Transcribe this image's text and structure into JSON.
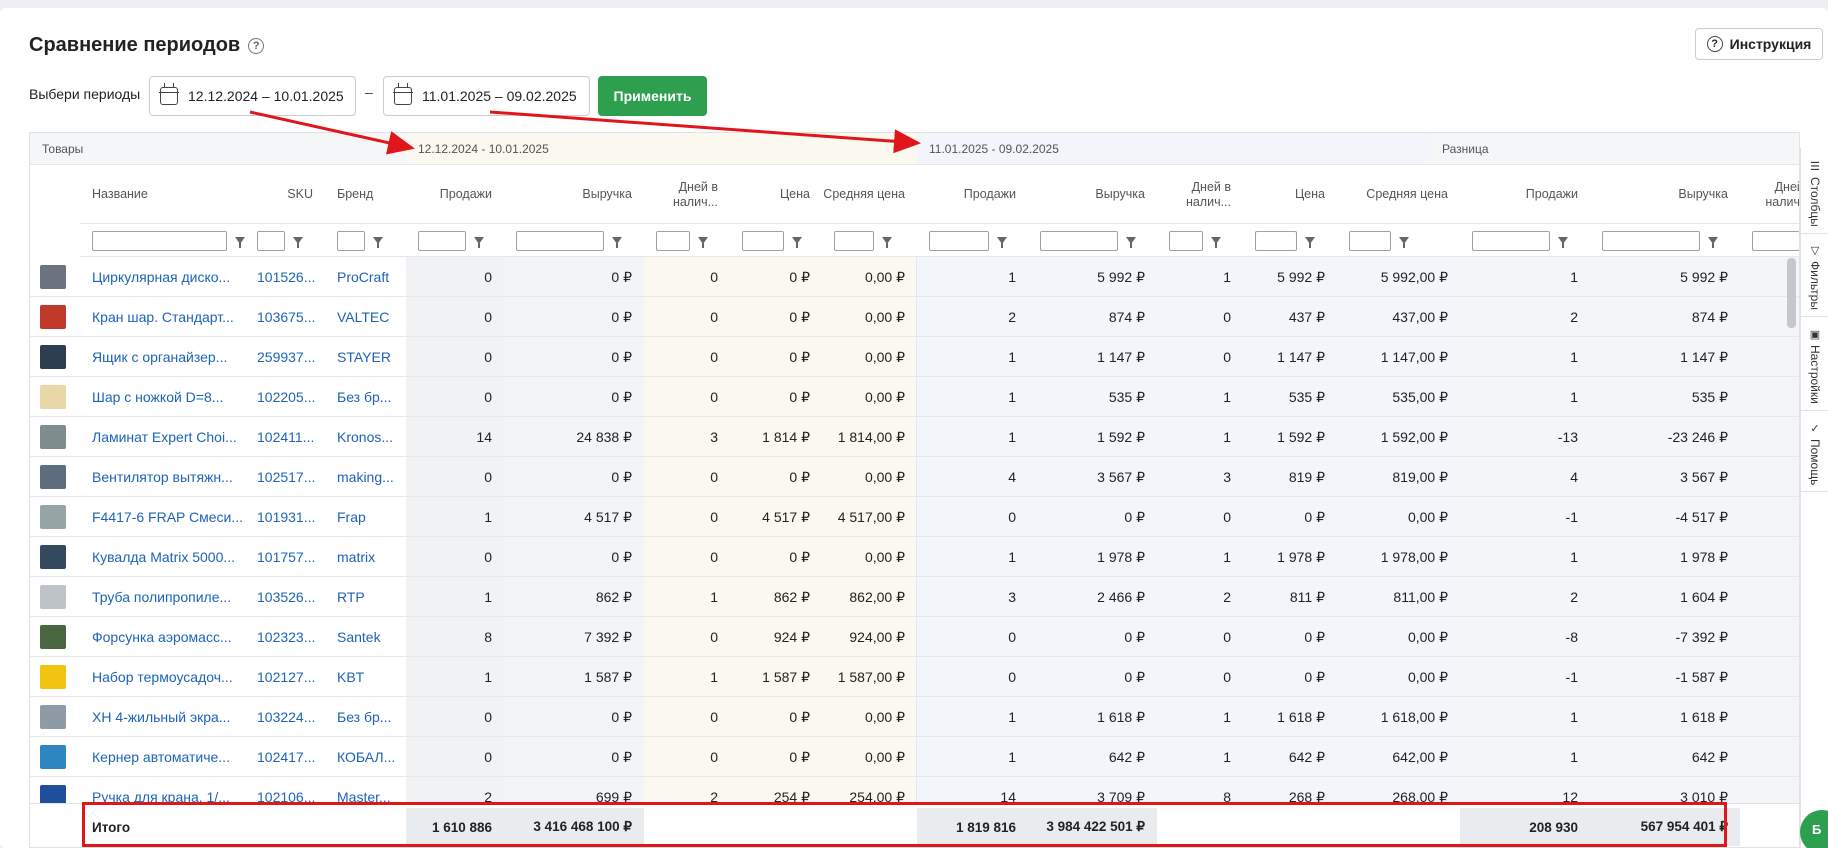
{
  "page": {
    "title": "Сравнение периодов",
    "help_icon": "?",
    "instruction_button": "Инструкция",
    "period_label": "Выбери периоды",
    "period1_value": "12.12.2024 – 10.01.2025",
    "separator": "–",
    "period2_value": "11.01.2025 – 09.02.2025",
    "apply_button": "Применить"
  },
  "table": {
    "groups": {
      "goods": "Товары",
      "period1": "12.12.2024 - 10.01.2025",
      "period2": "11.01.2025 - 09.02.2025",
      "diff": "Разница"
    },
    "headers": {
      "name": "Название",
      "sku": "SKU",
      "brand": "Бренд",
      "p1_sales": "Продажи",
      "p1_revenue": "Выручка",
      "p1_days": "Дней в налич...",
      "p1_price": "Цена",
      "p1_avg_price": "Средняя цена",
      "p2_sales": "Продажи",
      "p2_revenue": "Выручка",
      "p2_days": "Дней в налич...",
      "p2_price": "Цена",
      "p2_avg_price": "Средняя цена",
      "d_sales": "Продажи",
      "d_revenue": "Выручка",
      "d_days": "Дней в наличии"
    },
    "rows": [
      {
        "name": "Циркулярная диско...",
        "sku": "101526...",
        "brand": "ProCraft",
        "p1": [
          "0",
          "0 ₽",
          "0",
          "0 ₽",
          "0,00 ₽"
        ],
        "p2": [
          "1",
          "5 992 ₽",
          "1",
          "5 992 ₽",
          "5 992,00 ₽"
        ],
        "d": [
          "1",
          "5 992 ₽"
        ]
      },
      {
        "name": "Кран шар. Стандарт...",
        "sku": "103675...",
        "brand": "VALTEC",
        "p1": [
          "0",
          "0 ₽",
          "0",
          "0 ₽",
          "0,00 ₽"
        ],
        "p2": [
          "2",
          "874 ₽",
          "0",
          "437 ₽",
          "437,00 ₽"
        ],
        "d": [
          "2",
          "874 ₽"
        ]
      },
      {
        "name": "Ящик с органайзер...",
        "sku": "259937...",
        "brand": "STAYER",
        "p1": [
          "0",
          "0 ₽",
          "0",
          "0 ₽",
          "0,00 ₽"
        ],
        "p2": [
          "1",
          "1 147 ₽",
          "0",
          "1 147 ₽",
          "1 147,00 ₽"
        ],
        "d": [
          "1",
          "1 147 ₽"
        ]
      },
      {
        "name": "Шар с ножкой D=8...",
        "sku": "102205...",
        "brand": "Без бр...",
        "p1": [
          "0",
          "0 ₽",
          "0",
          "0 ₽",
          "0,00 ₽"
        ],
        "p2": [
          "1",
          "535 ₽",
          "1",
          "535 ₽",
          "535,00 ₽"
        ],
        "d": [
          "1",
          "535 ₽"
        ]
      },
      {
        "name": "Ламинат Expert Choi...",
        "sku": "102411...",
        "brand": "Kronos...",
        "p1": [
          "14",
          "24 838 ₽",
          "3",
          "1 814 ₽",
          "1 814,00 ₽"
        ],
        "p2": [
          "1",
          "1 592 ₽",
          "1",
          "1 592 ₽",
          "1 592,00 ₽"
        ],
        "d": [
          "-13",
          "-23 246 ₽"
        ]
      },
      {
        "name": "Вентилятор вытяжн...",
        "sku": "102517...",
        "brand": "making...",
        "p1": [
          "0",
          "0 ₽",
          "0",
          "0 ₽",
          "0,00 ₽"
        ],
        "p2": [
          "4",
          "3 567 ₽",
          "3",
          "819 ₽",
          "819,00 ₽"
        ],
        "d": [
          "4",
          "3 567 ₽"
        ]
      },
      {
        "name": "F4417-6 FRAP Смеси...",
        "sku": "101931...",
        "brand": "Frap",
        "p1": [
          "1",
          "4 517 ₽",
          "0",
          "4 517 ₽",
          "4 517,00 ₽"
        ],
        "p2": [
          "0",
          "0 ₽",
          "0",
          "0 ₽",
          "0,00 ₽"
        ],
        "d": [
          "-1",
          "-4 517 ₽"
        ]
      },
      {
        "name": "Кувалда Matrix 5000...",
        "sku": "101757...",
        "brand": "matrix",
        "p1": [
          "0",
          "0 ₽",
          "0",
          "0 ₽",
          "0,00 ₽"
        ],
        "p2": [
          "1",
          "1 978 ₽",
          "1",
          "1 978 ₽",
          "1 978,00 ₽"
        ],
        "d": [
          "1",
          "1 978 ₽"
        ]
      },
      {
        "name": "Труба полипропиле...",
        "sku": "103526...",
        "brand": "RTP",
        "p1": [
          "1",
          "862 ₽",
          "1",
          "862 ₽",
          "862,00 ₽"
        ],
        "p2": [
          "3",
          "2 466 ₽",
          "2",
          "811 ₽",
          "811,00 ₽"
        ],
        "d": [
          "2",
          "1 604 ₽"
        ]
      },
      {
        "name": "Форсунка аэромасс...",
        "sku": "102323...",
        "brand": "Santek",
        "p1": [
          "8",
          "7 392 ₽",
          "0",
          "924 ₽",
          "924,00 ₽"
        ],
        "p2": [
          "0",
          "0 ₽",
          "0",
          "0 ₽",
          "0,00 ₽"
        ],
        "d": [
          "-8",
          "-7 392 ₽"
        ]
      },
      {
        "name": "Набор термоусадоч...",
        "sku": "102127...",
        "brand": "KBT",
        "p1": [
          "1",
          "1 587 ₽",
          "1",
          "1 587 ₽",
          "1 587,00 ₽"
        ],
        "p2": [
          "0",
          "0 ₽",
          "0",
          "0 ₽",
          "0,00 ₽"
        ],
        "d": [
          "-1",
          "-1 587 ₽"
        ]
      },
      {
        "name": "ХН 4-жильный экра...",
        "sku": "103224...",
        "brand": "Без бр...",
        "p1": [
          "0",
          "0 ₽",
          "0",
          "0 ₽",
          "0,00 ₽"
        ],
        "p2": [
          "1",
          "1 618 ₽",
          "1",
          "1 618 ₽",
          "1 618,00 ₽"
        ],
        "d": [
          "1",
          "1 618 ₽"
        ]
      },
      {
        "name": "Кернер автоматиче...",
        "sku": "102417...",
        "brand": "КОБАЛ...",
        "p1": [
          "0",
          "0 ₽",
          "0",
          "0 ₽",
          "0,00 ₽"
        ],
        "p2": [
          "1",
          "642 ₽",
          "1",
          "642 ₽",
          "642,00 ₽"
        ],
        "d": [
          "1",
          "642 ₽"
        ]
      },
      {
        "name": "Ручка для крана, 1/...",
        "sku": "102106...",
        "brand": "Master...",
        "p1": [
          "2",
          "699 ₽",
          "2",
          "254 ₽",
          "254,00 ₽"
        ],
        "p2": [
          "14",
          "3 709 ₽",
          "8",
          "268 ₽",
          "268,00 ₽"
        ],
        "d": [
          "12",
          "3 010 ₽"
        ]
      }
    ],
    "totals": {
      "label": "Итого",
      "p1_sales": "1 610 886",
      "p1_revenue": "3 416 468 100 ₽",
      "p2_sales": "1 819 816",
      "p2_revenue": "3 984 422 501 ₽",
      "d_sales": "208 930",
      "d_revenue": "567 954 401 ₽"
    }
  },
  "sidebar": {
    "columns": "Столбцы",
    "filters": "Фильтры",
    "settings": "Настройки",
    "help": "Помощь"
  },
  "fab_label": "Б",
  "colors": {
    "accent_green": "#2e9e4f",
    "link_blue": "#1d63b8",
    "annotation_red": "#e0161b",
    "period1_bg": "#fbf8ef",
    "period2_bg": "#f2f6fa"
  }
}
